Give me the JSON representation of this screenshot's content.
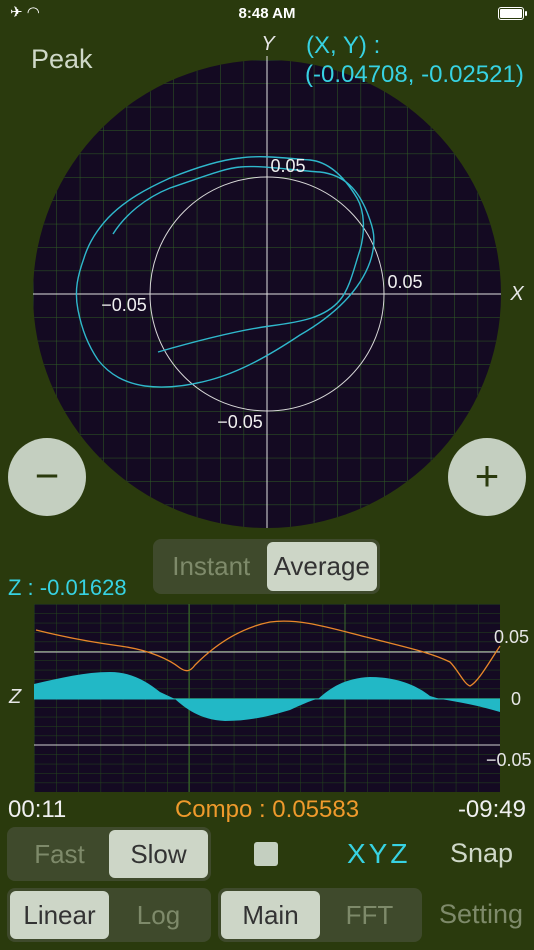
{
  "status_bar": {
    "time": "8:48 AM",
    "left_icons": "✈ ◠"
  },
  "plot": {
    "mode_label": "Peak",
    "xy_label": "(X, Y)  :",
    "xy_value": "(-0.04708, -0.02521)",
    "axis_x": "X",
    "axis_y": "Y",
    "tick_pos_x": "0.05",
    "tick_neg_x": "−0.05",
    "tick_pos_y": "0.05",
    "tick_neg_y": "−0.05"
  },
  "zoom": {
    "minus_label": "−",
    "plus_label": "+"
  },
  "avg_toggle": {
    "options": [
      "Instant",
      "Average"
    ],
    "selected": "Average"
  },
  "z_panel": {
    "label": "Z : -0.01628",
    "axis": "Z",
    "tick_top": "0.05",
    "tick_mid": "0",
    "tick_bot": "−0.05"
  },
  "footer": {
    "elapsed": "00:11",
    "compo": "Compo : 0.05583",
    "remaining": "-09:49"
  },
  "speed_toggle": {
    "options": [
      "Fast",
      "Slow"
    ],
    "selected": "Slow"
  },
  "controls": {
    "xyz_label": "XYZ",
    "snap_label": "Snap",
    "setting_label": "Setting"
  },
  "scale_toggle": {
    "options": [
      "Linear",
      "Log"
    ],
    "selected": "Linear"
  },
  "view_toggle": {
    "options": [
      "Main",
      "FFT"
    ],
    "selected": "Main"
  },
  "colors": {
    "background": "#2a3a0d",
    "accent": "#37d2e2",
    "compo": "#ef9a2c",
    "grid": "#3b7a2a",
    "plot_bg": "#140a22"
  }
}
